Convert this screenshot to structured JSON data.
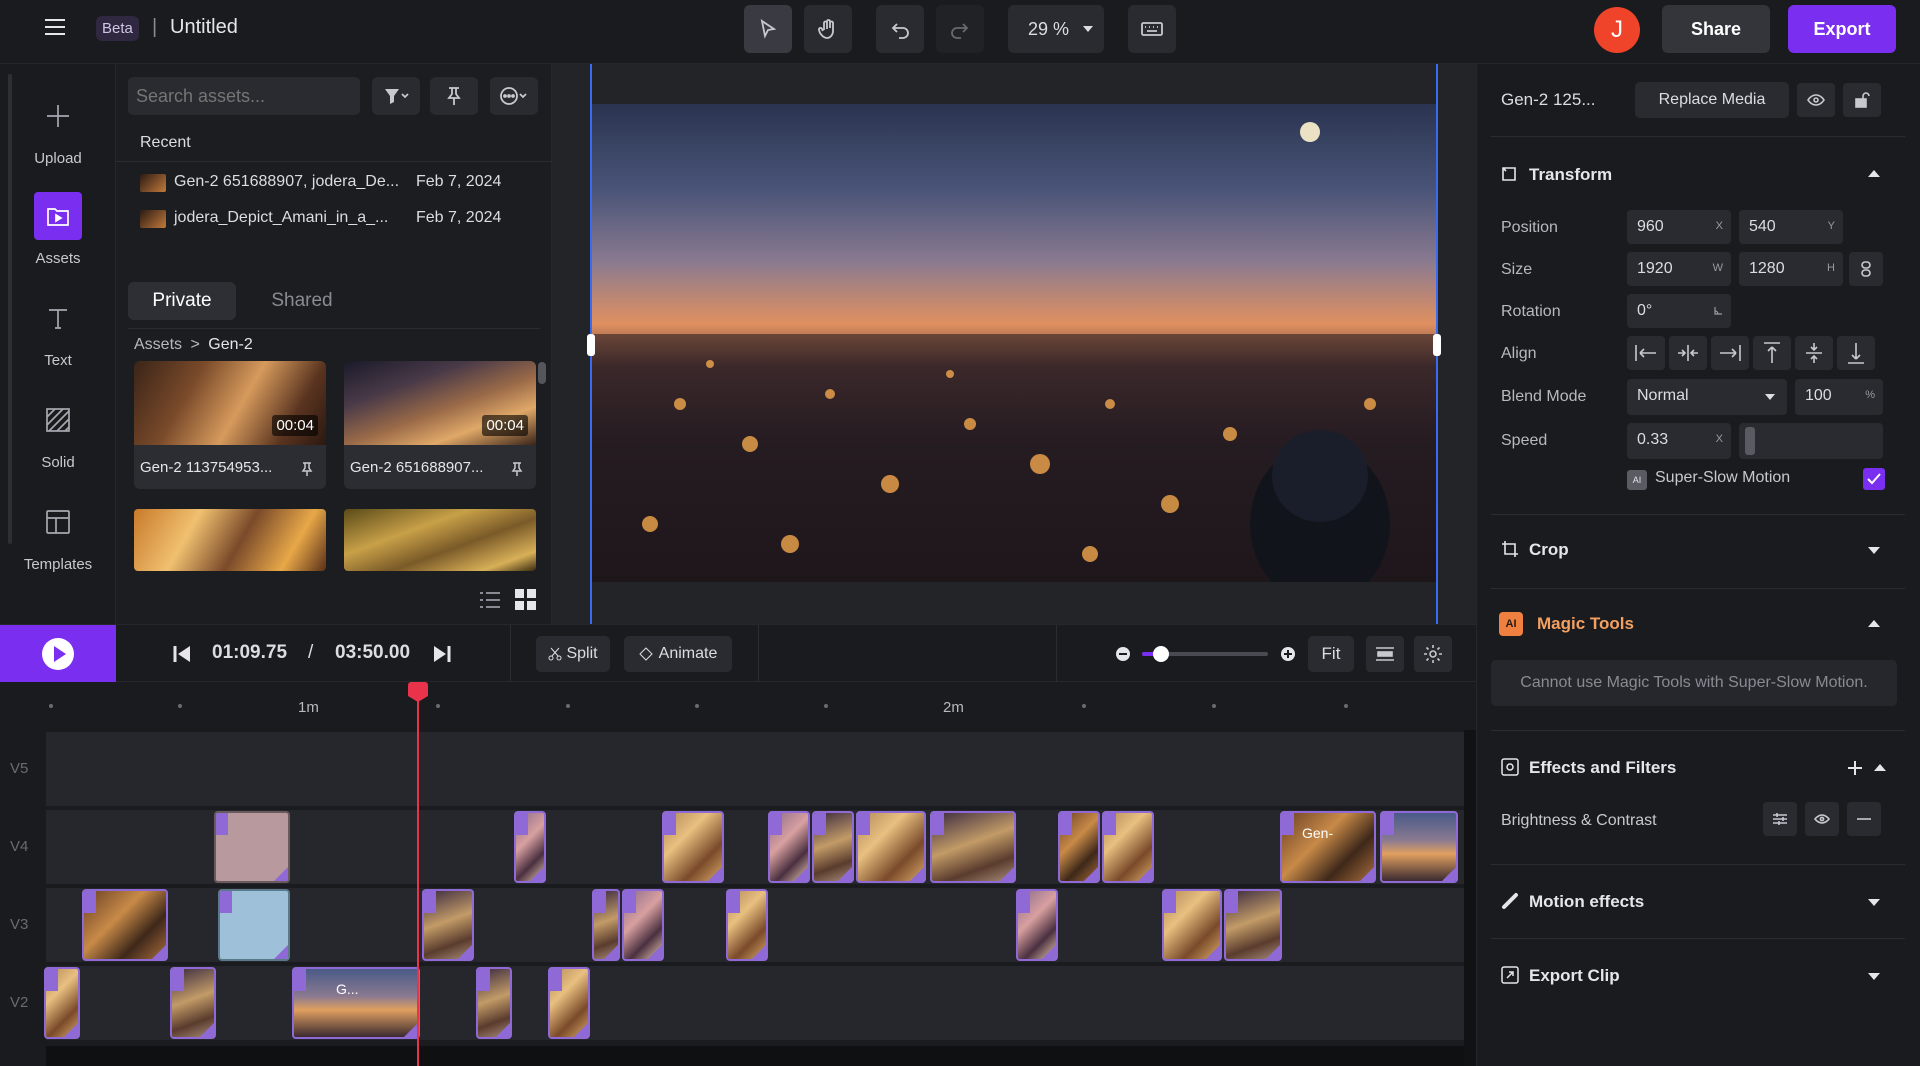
{
  "topbar": {
    "badge": "Beta",
    "separator": "|",
    "title": "Untitled",
    "zoom": "29 %",
    "avatar_initial": "J",
    "share_label": "Share",
    "export_label": "Export"
  },
  "rail": {
    "items": [
      {
        "label": "Upload",
        "icon": "plus-icon"
      },
      {
        "label": "Assets",
        "icon": "assets-icon"
      },
      {
        "label": "Text",
        "icon": "text-icon"
      },
      {
        "label": "Solid",
        "icon": "solid-icon"
      },
      {
        "label": "Templates",
        "icon": "templates-icon"
      }
    ]
  },
  "assets": {
    "search_placeholder": "Search assets...",
    "recent_heading": "Recent",
    "recent": [
      {
        "name": "Gen-2 651688907, jodera_De...",
        "date": "Feb 7, 2024"
      },
      {
        "name": "jodera_Depict_Amani_in_a_...",
        "date": "Feb 7, 2024"
      }
    ],
    "tabs": {
      "private": "Private",
      "shared": "Shared"
    },
    "breadcrumb": {
      "root": "Assets",
      "sep": ">",
      "folder": "Gen-2"
    },
    "grid": [
      {
        "name": "Gen-2 113754953...",
        "duration": "00:04"
      },
      {
        "name": "Gen-2 651688907...",
        "duration": "00:04"
      }
    ]
  },
  "transport": {
    "current_time": "01:09.75",
    "time_sep": "/",
    "total_time": "03:50.00",
    "split_label": "Split",
    "animate_label": "Animate",
    "fit_label": "Fit",
    "zoom_level": 0.15
  },
  "timeline": {
    "ruler": {
      "mark1": "1m",
      "mark2": "2m"
    },
    "tracks": [
      "V5",
      "V4",
      "V3",
      "V2"
    ],
    "clip_labels": {
      "v4_gen": "Gen-",
      "v2_g": "G..."
    }
  },
  "props": {
    "media_name": "Gen-2 125...",
    "replace_label": "Replace Media",
    "transform": {
      "heading": "Transform",
      "position_label": "Position",
      "pos_x": "960",
      "pos_x_suffix": "X",
      "pos_y": "540",
      "pos_y_suffix": "Y",
      "size_label": "Size",
      "width": "1920",
      "width_suffix": "W",
      "height": "1280",
      "height_suffix": "H",
      "rotation_label": "Rotation",
      "rotation": "0°",
      "align_label": "Align",
      "blend_label": "Blend Mode",
      "blend_mode": "Normal",
      "opacity": "100",
      "opacity_suffix": "%",
      "speed_label": "Speed",
      "speed": "0.33",
      "speed_suffix": "X",
      "slowmo_badge": "AI",
      "slowmo_label": "Super-Slow Motion",
      "slowmo_checked": true
    },
    "crop_heading": "Crop",
    "magic": {
      "badge": "AI",
      "heading": "Magic Tools",
      "notice": "Cannot use Magic Tools with Super-Slow Motion."
    },
    "effects": {
      "heading": "Effects and Filters",
      "item": "Brightness & Contrast"
    },
    "motion_heading": "Motion effects",
    "export_clip_heading": "Export Clip"
  },
  "colors": {
    "accent": "#7a2ff0",
    "playhead": "#e8334a",
    "clip_border": "#8f69d6"
  }
}
